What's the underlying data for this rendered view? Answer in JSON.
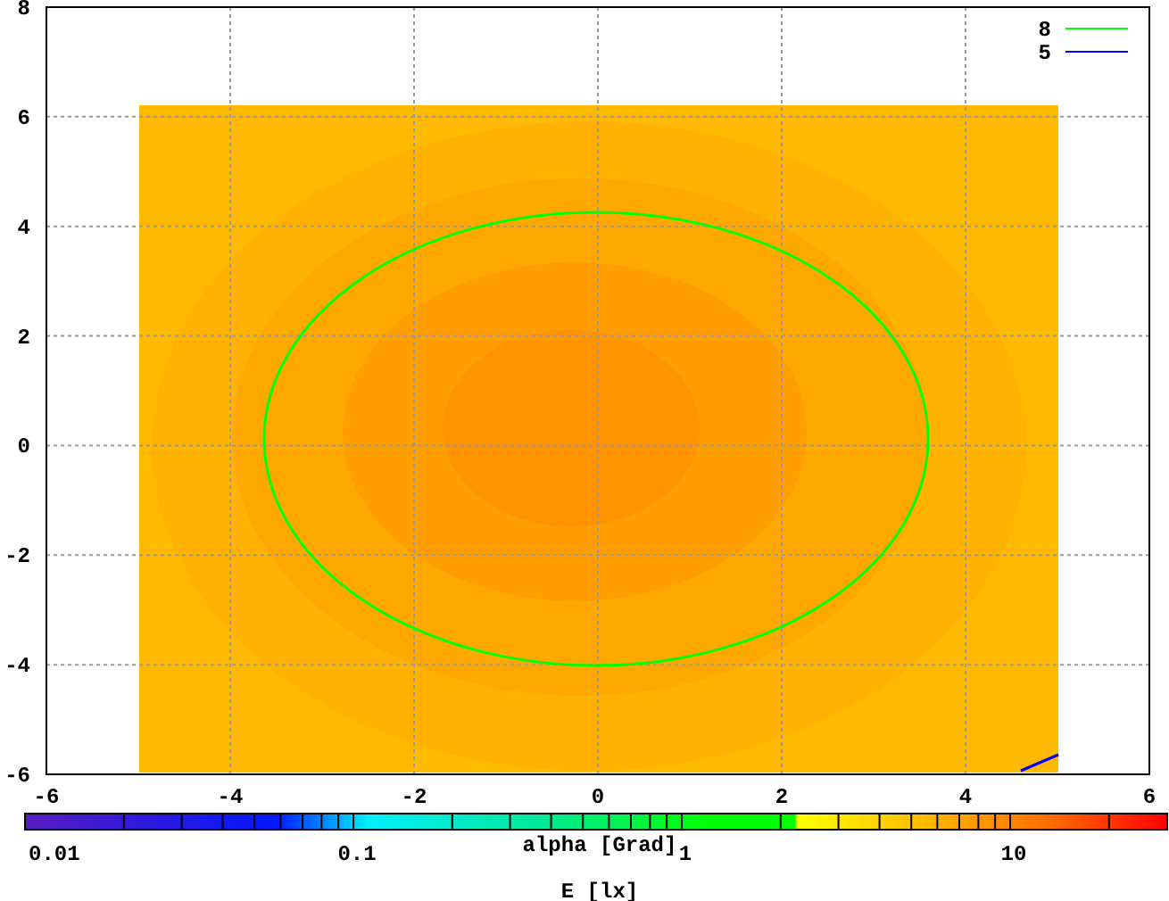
{
  "plot": {
    "xticks": [
      "-6",
      "-4",
      "-2",
      "0",
      "2",
      "4",
      "6"
    ],
    "yticks": [
      "8",
      "6",
      "4",
      "2",
      "0",
      "-2",
      "-4",
      "-6"
    ],
    "legend": [
      {
        "label": "8",
        "color": "#00ff00"
      },
      {
        "label": "5",
        "color": "#0000ff"
      }
    ]
  },
  "colorbar": {
    "ticks": [
      "0.01",
      "0.1",
      "1",
      "10"
    ],
    "label": "alpha [Grad]",
    "xlabel": "E [lx]"
  }
}
